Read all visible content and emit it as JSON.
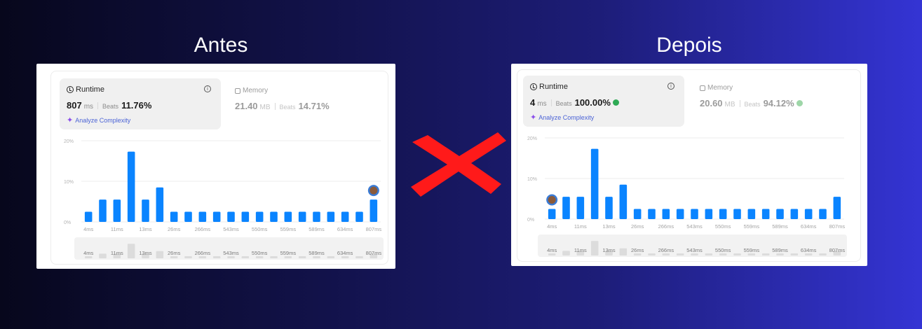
{
  "titles": {
    "before": "Antes",
    "after": "Depois"
  },
  "before": {
    "runtime_label": "Runtime",
    "runtime_value": "807",
    "runtime_unit": "ms",
    "beats_label": "Beats",
    "runtime_beats": "11.76%",
    "analyze_label": "Analyze Complexity",
    "memory_label": "Memory",
    "memory_value": "21.40",
    "memory_unit": "MB",
    "memory_beats": "14.71%",
    "medal": false
  },
  "after": {
    "runtime_label": "Runtime",
    "runtime_value": "4",
    "runtime_unit": "ms",
    "beats_label": "Beats",
    "runtime_beats": "100.00%",
    "analyze_label": "Analyze Complexity",
    "memory_label": "Memory",
    "memory_value": "20.60",
    "memory_unit": "MB",
    "memory_beats": "94.12%",
    "medal": true
  },
  "chart_data": [
    {
      "type": "bar",
      "title": "",
      "ylabel": "",
      "ylim": [
        0,
        20
      ],
      "yticks": [
        "0%",
        "10%",
        "20%"
      ],
      "values": [
        2.5,
        5.5,
        5.5,
        17.3,
        5.5,
        8.5,
        2.5,
        2.5,
        2.5,
        2.5,
        2.5,
        2.5,
        2.5,
        2.5,
        2.5,
        2.5,
        2.5,
        2.5,
        2.5,
        2.5,
        5.5
      ],
      "xtick_labels": [
        "4ms",
        "11ms",
        "13ms",
        "26ms",
        "266ms",
        "543ms",
        "550ms",
        "559ms",
        "589ms",
        "634ms",
        "807ms"
      ],
      "highlight_bar_index": 20,
      "highlight_label": "807ms",
      "grid": true
    },
    {
      "type": "bar",
      "title": "",
      "ylabel": "",
      "ylim": [
        0,
        20
      ],
      "yticks": [
        "0%",
        "10%",
        "20%"
      ],
      "values": [
        2.5,
        5.5,
        5.5,
        17.3,
        5.5,
        8.5,
        2.5,
        2.5,
        2.5,
        2.5,
        2.5,
        2.5,
        2.5,
        2.5,
        2.5,
        2.5,
        2.5,
        2.5,
        2.5,
        2.5,
        5.5
      ],
      "xtick_labels": [
        "4ms",
        "11ms",
        "13ms",
        "26ms",
        "266ms",
        "543ms",
        "550ms",
        "559ms",
        "589ms",
        "634ms",
        "807ms"
      ],
      "highlight_bar_index": 0,
      "highlight_label": "4ms",
      "grid": true
    }
  ],
  "colors": {
    "bar": "#0a84ff",
    "cross": "#ff1a1a",
    "avatar": "#3a7bd5"
  }
}
